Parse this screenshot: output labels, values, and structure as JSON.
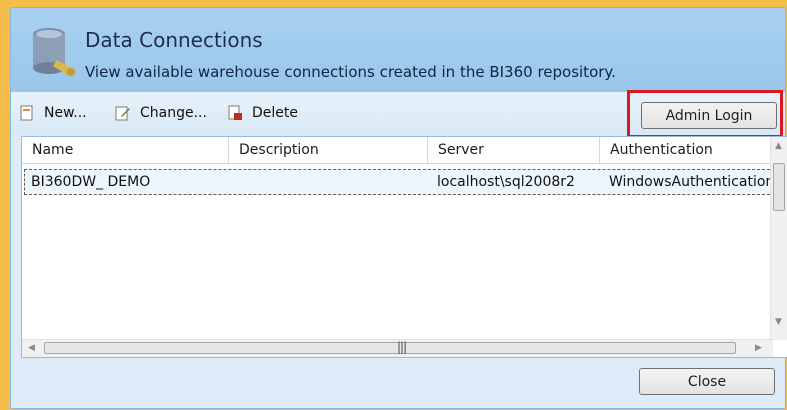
{
  "header": {
    "title": "Data Connections",
    "subtitle": "View available warehouse connections created in the BI360 repository."
  },
  "toolbar": {
    "new_label": "New...",
    "change_label": "Change...",
    "delete_label": "Delete",
    "admin_login_label": "Admin Login"
  },
  "grid": {
    "columns": [
      "Name",
      "Description",
      "Server",
      "Authentication"
    ],
    "rows": [
      {
        "name": "BI360DW_ DEMO",
        "description": "",
        "server": "localhost\\sql2008r2",
        "authentication": "WindowsAuthentication"
      }
    ]
  },
  "footer": {
    "close_label": "Close"
  },
  "colors": {
    "outer_border": "#f5be4b",
    "header_bg": "#a9d1f1",
    "highlight": "#d9181f"
  },
  "icons": [
    "database-icon",
    "new-icon",
    "change-icon",
    "delete-icon"
  ]
}
